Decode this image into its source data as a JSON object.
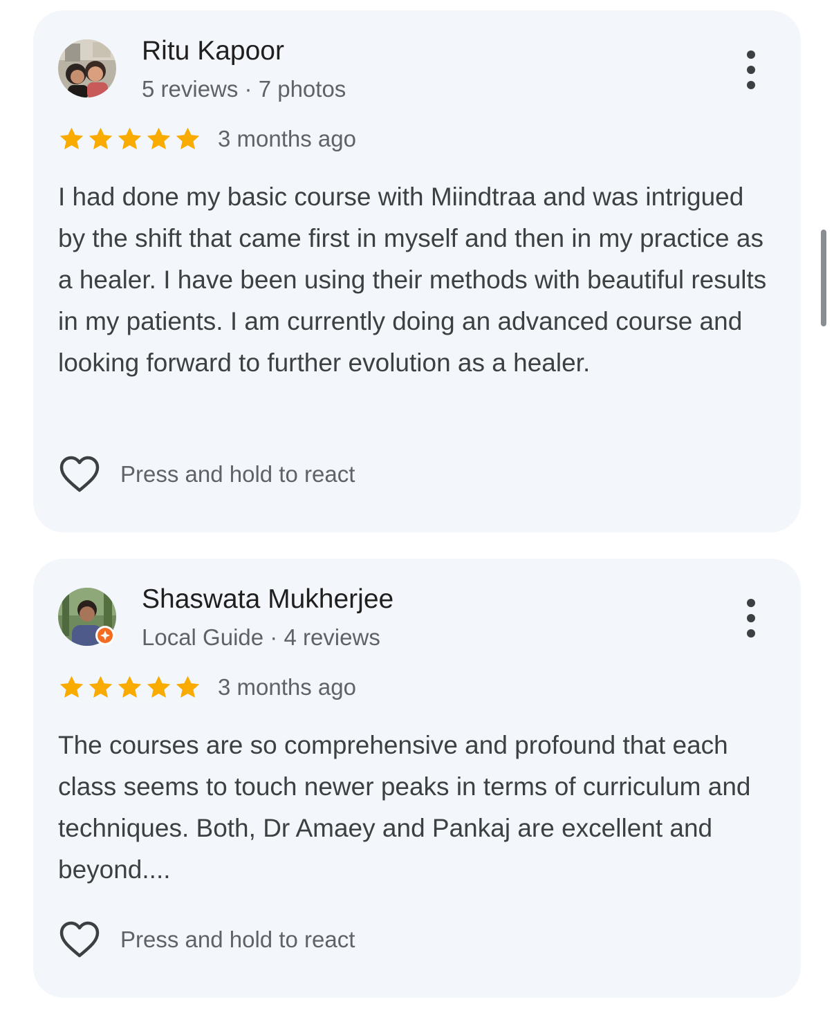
{
  "colors": {
    "card_background": "#f3f6fa",
    "star": "#f9ab00",
    "primary_text": "#1f1f1f",
    "secondary_text": "#5f6368",
    "body_text": "#3c4043",
    "local_guide_badge": "#f36c21"
  },
  "reviews": [
    {
      "name": "Ritu Kapoor",
      "meta": "5 reviews · 7 photos",
      "rating": 5,
      "time": "3 months ago",
      "text": "I had done my basic course with Miindtraa and was intrigued by the shift that came first in myself and then in my practice as a healer. I have been using their methods with beautiful results in my patients. I am currently doing an advanced course and looking forward to further evolution as a healer.",
      "react_label": "Press and hold to react",
      "avatar_icon": "profile-photo",
      "menu_icon": "more-vert-icon"
    },
    {
      "name": "Shaswata Mukherjee",
      "meta": "Local Guide · 4 reviews",
      "rating": 5,
      "time": "3 months ago",
      "text": "The courses are so comprehensive and profound that each class seems to touch newer peaks in terms of curriculum and techniques. Both, Dr Amaey and Pankaj are excellent and beyond....",
      "react_label": "Press and hold to react",
      "avatar_icon": "profile-photo",
      "badge_icon": "local-guide-badge-icon",
      "menu_icon": "more-vert-icon"
    }
  ]
}
